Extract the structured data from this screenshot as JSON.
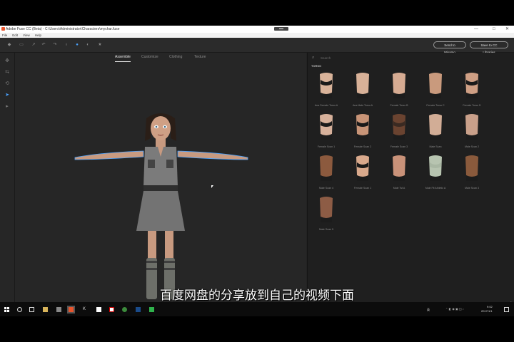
{
  "window": {
    "title": "Adobe Fuse CC (Beta) - C:\\Users\\Administrator\\Characters\\mychar.fuse",
    "controls": [
      "—",
      "□",
      "✕"
    ]
  },
  "menu": [
    "File",
    "Edit",
    "View",
    "Help"
  ],
  "toolbar": {
    "send_mixamo": "Send to Mixamo",
    "save_cc": "Save to CC Libraries"
  },
  "tabs": [
    "Assemble",
    "Customize",
    "Clothing",
    "Texture"
  ],
  "active_tab": "Assemble",
  "panel": {
    "search_placeholder": "Search",
    "section": "TORSO",
    "libraries_label": "LIB",
    "items": [
      {
        "label": "Ana Female Torso A",
        "skin": "#d9b39a",
        "top": "#1a1a1a"
      },
      {
        "label": "Ana Male Torso A",
        "skin": "#d8b198",
        "top": null
      },
      {
        "label": "Female Torso B",
        "skin": "#d6ab92",
        "top": null
      },
      {
        "label": "Female Torso C",
        "skin": "#c99a7d",
        "top": null
      },
      {
        "label": "Female Torso D",
        "skin": "#cf9f84",
        "top": "#1a1a1a"
      },
      {
        "label": "Female Scan 1",
        "skin": "#d7b19b",
        "top": "#1a1a1a"
      },
      {
        "label": "Female Scan 2",
        "skin": "#c89477",
        "top": "#1a1a1a"
      },
      {
        "label": "Female Scan 3",
        "skin": "#6a4330",
        "top": "#3a2a22"
      },
      {
        "label": "Male Scan",
        "skin": "#d2ad96",
        "top": null
      },
      {
        "label": "Male Scan 2",
        "skin": "#c9a08a",
        "top": null
      },
      {
        "label": "Male Scan 4",
        "skin": "#8c5a3e",
        "top": null
      },
      {
        "label": "Female Scan 1",
        "skin": "#d9a98c",
        "top": "#1a1a1a"
      },
      {
        "label": "Male Tst A",
        "skin": "#c99279",
        "top": null
      },
      {
        "label": "Male Fit Athletic A",
        "skin": "#b7c4b0",
        "top": "#a9b7a3"
      },
      {
        "label": "Male Scan 3",
        "skin": "#8a5a3c",
        "top": null
      },
      {
        "label": "Male Scan 5",
        "skin": "#8d5c45",
        "top": null
      }
    ]
  },
  "subtitle": "百度网盘的分享放到自己的视频下面",
  "taskbar": {
    "lang": "英",
    "time": "9:02",
    "date": "2017/1/1"
  },
  "colors": {
    "accent": "#4aa3ff",
    "outfit": "#7b7b7b"
  }
}
